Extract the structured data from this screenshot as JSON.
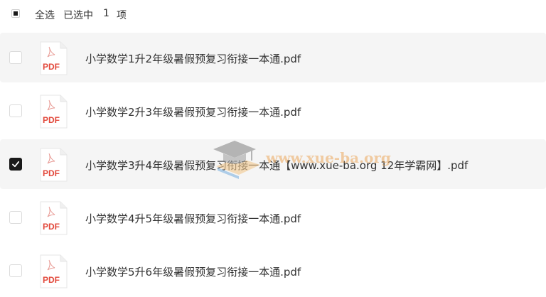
{
  "header": {
    "select_all_label": "全选",
    "selected_prefix": "已选中",
    "selected_count": "1",
    "selected_unit": "项"
  },
  "files": [
    {
      "name": "小学数学1升2年级暑假预复习衔接一本通.pdf",
      "checked": false,
      "icon_label": "PDF"
    },
    {
      "name": "小学数学2升3年级暑假预复习衔接一本通.pdf",
      "checked": false,
      "icon_label": "PDF"
    },
    {
      "name": "小学数学3升4年级暑假预复习衔接一本通【www.xue-ba.org 12年学霸网】.pdf",
      "checked": true,
      "icon_label": "PDF"
    },
    {
      "name": "小学数学4升5年级暑假预复习衔接一本通.pdf",
      "checked": false,
      "icon_label": "PDF"
    },
    {
      "name": "小学数学5升6年级暑假预复习衔接一本通.pdf",
      "checked": false,
      "icon_label": "PDF"
    }
  ],
  "watermark": {
    "text": "www.xue-ba.org"
  },
  "colors": {
    "pdf_red": "#e2483b",
    "row_shade": "#f5f5f5",
    "checkbox_checked": "#1a1a1a"
  }
}
